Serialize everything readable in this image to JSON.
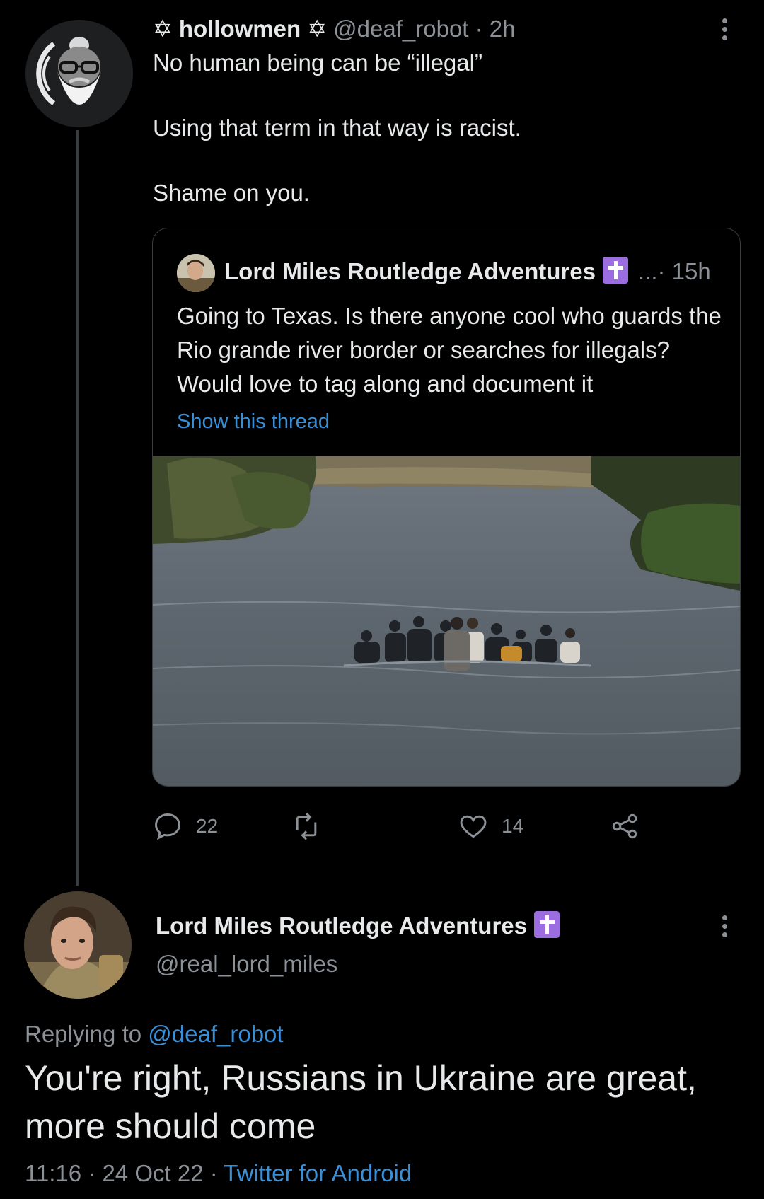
{
  "tweet": {
    "name_prefix": "✡",
    "name": "hollowmen",
    "name_suffix": "✡",
    "handle": "@deaf_robot",
    "time": "· 2h",
    "text": "No human being can be “illegal”\n\nUsing that term in that way is racist.\n\nShame on you.",
    "avatar_icon": "bearded-man-illustration-icon"
  },
  "quote": {
    "name": "Lord Miles Routledge Adventures",
    "badge_icon": "cross-icon",
    "meta": "...· 15h",
    "text": "Going to Texas. Is there anyone cool who guards the Rio grande river border or searches for illegals? Would love to tag along and document it",
    "show_thread": "Show this thread",
    "photo_icon": "river-crossing-photo"
  },
  "actions": {
    "reply_count": "22",
    "retweet_count": "",
    "like_count": "14",
    "reply_icon": "reply-bubble-icon",
    "retweet_icon": "retweet-icon",
    "like_icon": "heart-icon",
    "share_icon": "share-icon"
  },
  "reply": {
    "name": "Lord Miles Routledge Adventures",
    "handle": "@real_lord_miles",
    "replying_label": "Replying to",
    "replying_mention": "@deaf_robot",
    "text": "You're right, Russians in Ukraine are great, more should come",
    "time": "11:16 · 24 Oct 22 ·",
    "source": "Twitter for Android"
  },
  "colors": {
    "background": "#000000",
    "text": "#e7e9ea",
    "muted": "#8b9196",
    "link": "#3a8fd6",
    "badge": "#9b6de0"
  }
}
